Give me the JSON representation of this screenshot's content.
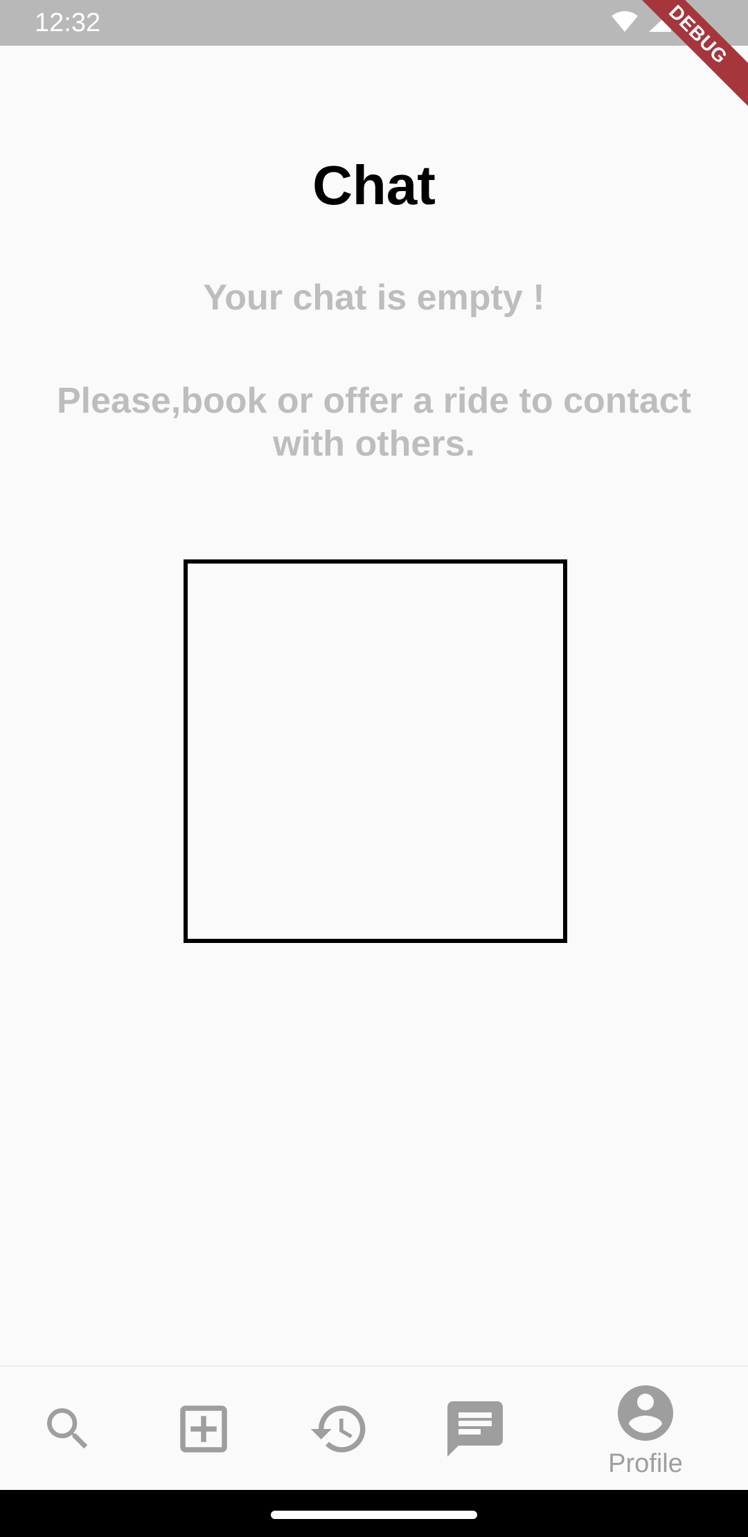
{
  "status_bar": {
    "time": "12:32",
    "icons": [
      "wifi-icon",
      "signal-icon",
      "battery-icon"
    ]
  },
  "debug_banner": "DEBUG",
  "page": {
    "title": "Chat",
    "empty_title": "Your chat is empty !",
    "empty_message": "Please,book or offer a ride to contact with others."
  },
  "bottom_nav": {
    "items": [
      {
        "icon": "search-icon",
        "label": ""
      },
      {
        "icon": "add-box-icon",
        "label": ""
      },
      {
        "icon": "history-icon",
        "label": ""
      },
      {
        "icon": "chat-icon",
        "label": ""
      },
      {
        "icon": "account-circle-icon",
        "label": "Profile"
      }
    ]
  },
  "colors": {
    "status_bar": "#b8b8b8",
    "background": "#fafafa",
    "muted_text": "#bdbdbd",
    "nav_icon": "#9e9e9e",
    "debug_ribbon": "#a4363c"
  }
}
